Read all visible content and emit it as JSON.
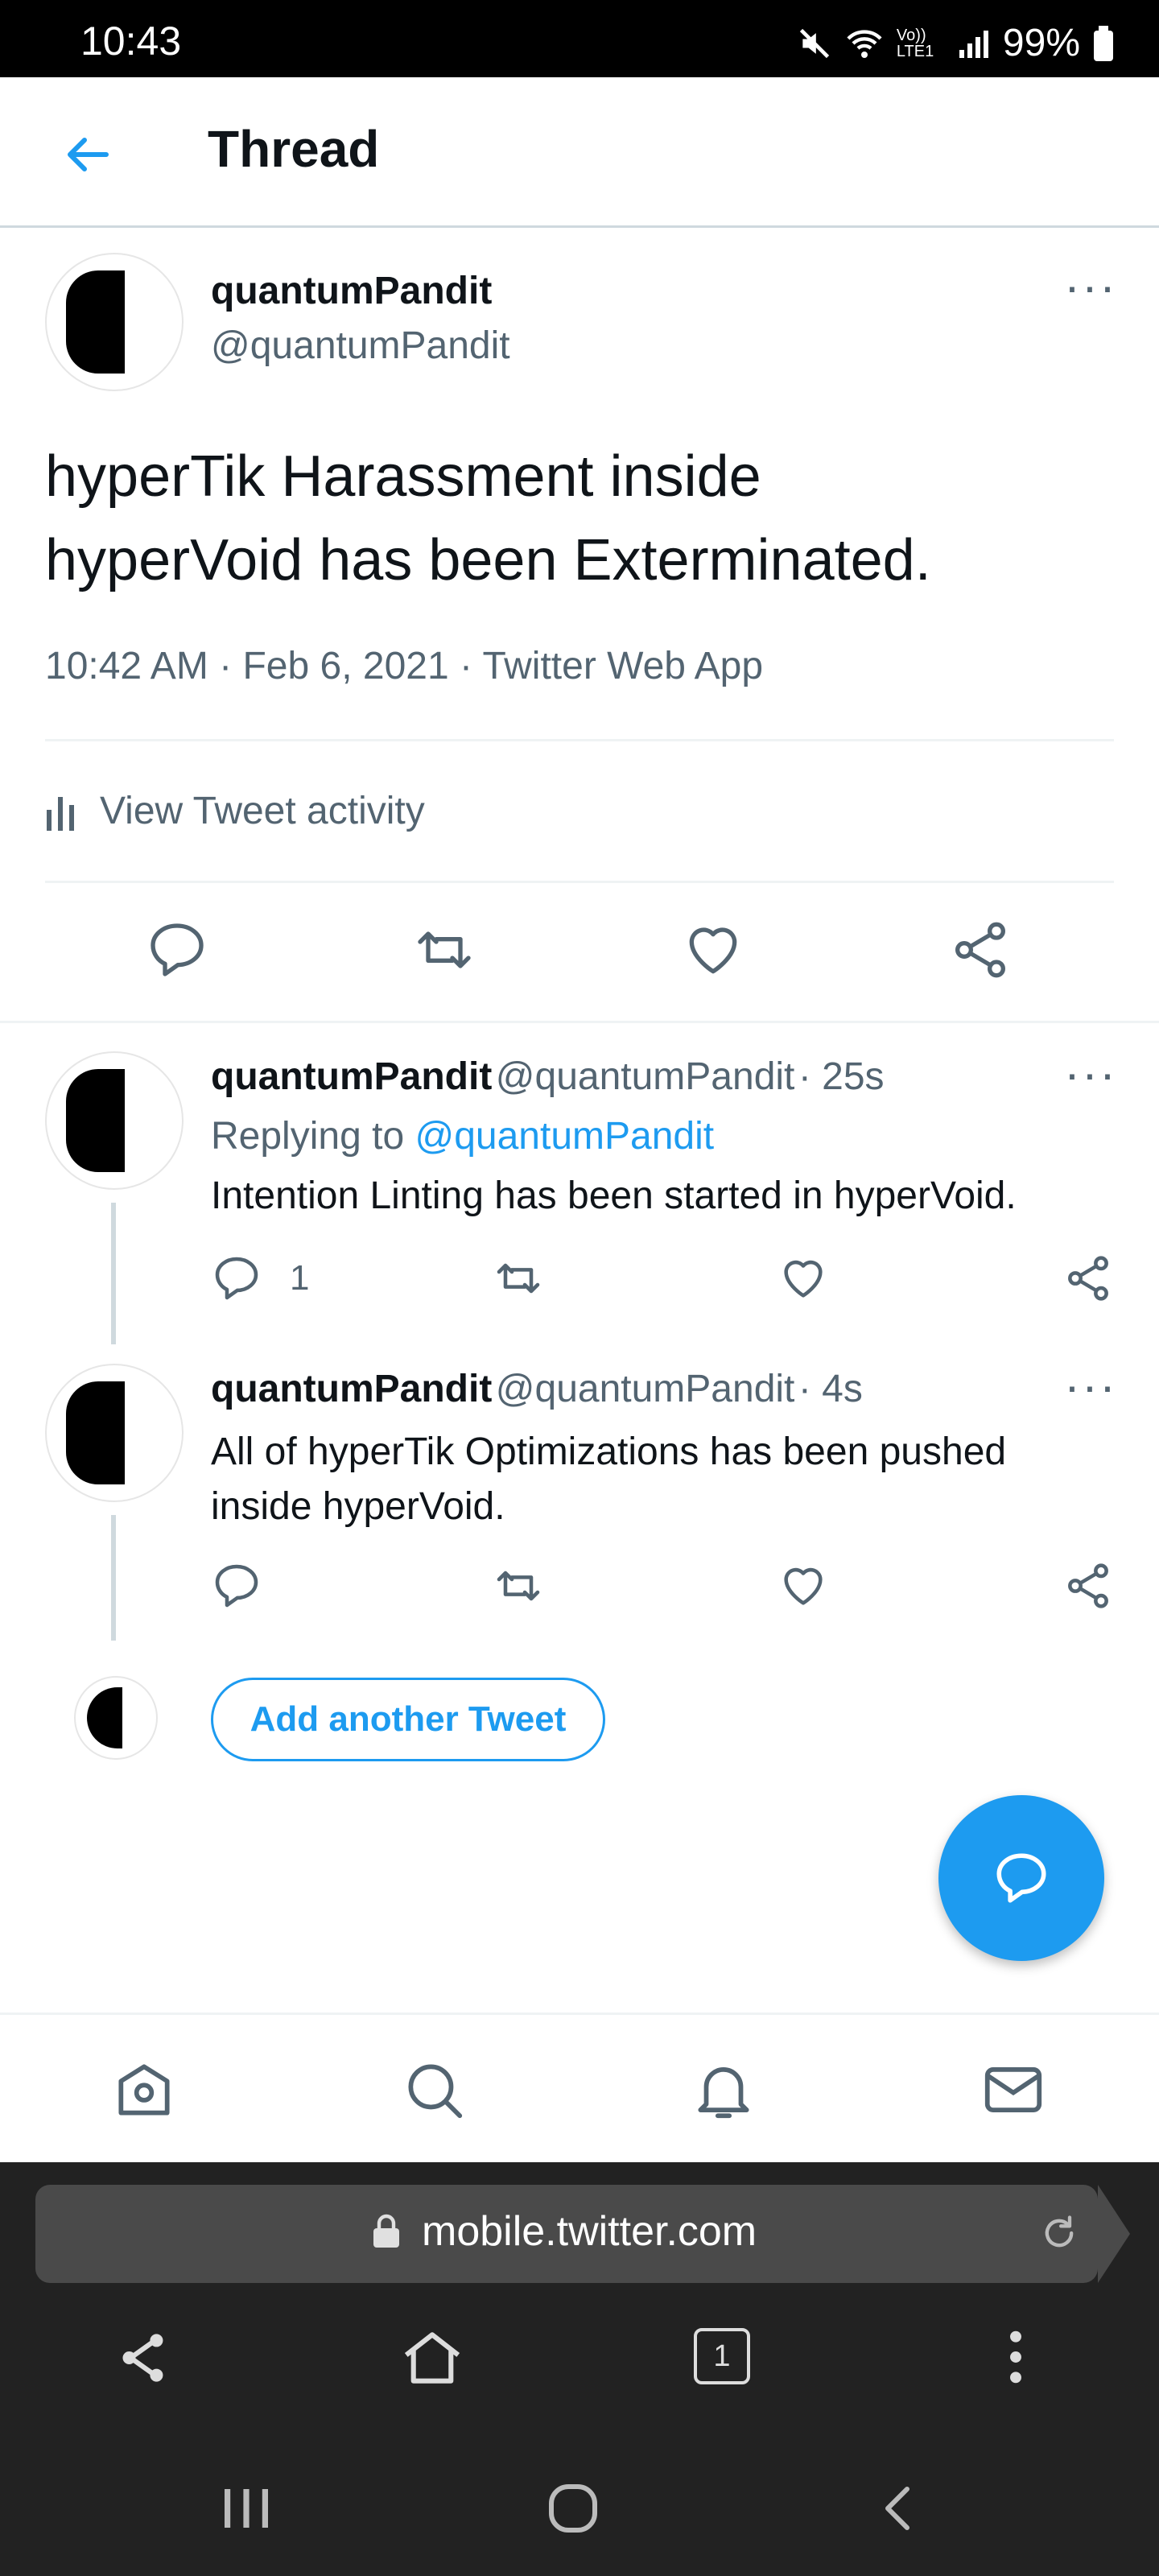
{
  "status_bar": {
    "time": "10:43",
    "battery": "99%",
    "network": "Vo)) LTE1"
  },
  "header": {
    "title": "Thread"
  },
  "main_tweet": {
    "name": "quantumPandit",
    "handle": "@quantumPandit",
    "text_line1": "hyperTik Harassment inside",
    "text_line2": "hyperVoid has been Exterminated.",
    "meta": "10:42 AM · Feb 6, 2021 · Twitter Web App",
    "activity": "View Tweet activity"
  },
  "replies": [
    {
      "name": "quantumPandit",
      "handle": "@quantumPandit",
      "time": "· 25s",
      "replying_prefix": "Replying to ",
      "replying_handle": "@quantumPandit",
      "text": "Intention Linting has been started in hyperVoid.",
      "reply_count": "1"
    },
    {
      "name": "quantumPandit",
      "handle": "@quantumPandit",
      "time": "· 4s",
      "text_line1": "All of hyperTik Optimizations has been pushed",
      "text_line2": "inside hyperVoid."
    }
  ],
  "add_tweet": {
    "label": "Add another Tweet"
  },
  "browser": {
    "url": "mobile.twitter.com",
    "tab_count": "1"
  },
  "colors": {
    "accent": "#1d9bf0",
    "text": "#0f1419",
    "muted": "#536471",
    "browser_bg": "#222222"
  },
  "icons": [
    "back-arrow-icon",
    "more-icon",
    "reply-icon",
    "retweet-icon",
    "like-icon",
    "share-icon",
    "activity-icon",
    "compose-icon",
    "home-icon",
    "search-icon",
    "notifications-icon",
    "messages-icon",
    "lock-icon",
    "refresh-icon",
    "tabs-icon",
    "menu-icon"
  ]
}
